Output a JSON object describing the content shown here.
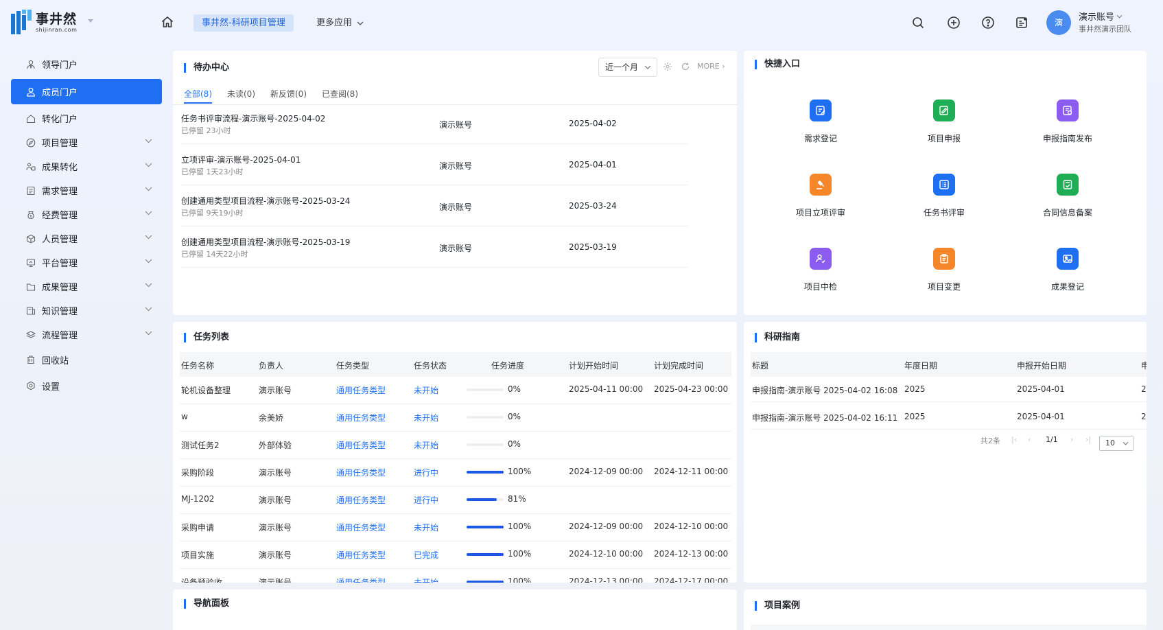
{
  "brand": {
    "name": "事井然",
    "sub": "shijinran.com",
    "accent": "#1e6ff1"
  },
  "header": {
    "current_app": "事井然-科研项目管理",
    "more_apps": "更多应用",
    "user": {
      "avatar_text": "演",
      "name": "演示账号",
      "team": "事井然演示团队"
    },
    "icons": [
      "home-icon",
      "search-icon",
      "add-circle-icon",
      "help-icon",
      "notice-icon"
    ]
  },
  "sidebar": {
    "items": [
      {
        "label": "领导门户",
        "icon": "user-tie-icon",
        "expandable": false
      },
      {
        "label": "成员门户",
        "icon": "user-icon",
        "expandable": false,
        "active": true
      },
      {
        "label": "转化门户",
        "icon": "home-outline-icon",
        "expandable": false
      },
      {
        "label": "项目管理",
        "icon": "compass-icon",
        "expandable": true
      },
      {
        "label": "成果转化",
        "icon": "exchange-icon",
        "expandable": true
      },
      {
        "label": "需求管理",
        "icon": "doc-icon",
        "expandable": true
      },
      {
        "label": "经费管理",
        "icon": "money-icon",
        "expandable": true
      },
      {
        "label": "人员管理",
        "icon": "cube-icon",
        "expandable": true
      },
      {
        "label": "平台管理",
        "icon": "monitor-icon",
        "expandable": true
      },
      {
        "label": "成果管理",
        "icon": "folder-icon",
        "expandable": true
      },
      {
        "label": "知识管理",
        "icon": "book-icon",
        "expandable": true
      },
      {
        "label": "流程管理",
        "icon": "layers-icon",
        "expandable": true
      },
      {
        "label": "回收站",
        "icon": "trash-icon",
        "expandable": false
      },
      {
        "label": "设置",
        "icon": "settings-icon",
        "expandable": false
      }
    ]
  },
  "todo": {
    "title": "待办中心",
    "period": "近一个月",
    "more": "MORE",
    "tabs": [
      "全部(8)",
      "未读(0)",
      "新反馈(0)",
      "已查阅(8)"
    ],
    "rows": [
      {
        "title": "任务书评审流程-演示账号-2025-04-02",
        "stay": "已停留 23小时",
        "user": "演示账号",
        "date": "2025-04-02"
      },
      {
        "title": "立项评审-演示账号-2025-04-01",
        "stay": "已停留 1天23小时",
        "user": "演示账号",
        "date": "2025-04-01"
      },
      {
        "title": "创建通用类型项目流程-演示账号-2025-03-24",
        "stay": "已停留 9天19小时",
        "user": "演示账号",
        "date": "2025-03-24"
      },
      {
        "title": "创建通用类型项目流程-演示账号-2025-03-19",
        "stay": "已停留 14天22小时",
        "user": "演示账号",
        "date": "2025-03-19"
      }
    ]
  },
  "quick_entry": {
    "title": "快捷入口",
    "items": [
      {
        "label": "需求登记",
        "color": "#1e6ff1",
        "icon": "edit-doc-icon"
      },
      {
        "label": "项目申报",
        "color": "#1fae55",
        "icon": "pen-doc-icon"
      },
      {
        "label": "申报指南发布",
        "color": "#8c5cf0",
        "icon": "guide-doc-icon"
      },
      {
        "label": "项目立项评审",
        "color": "#f5862a",
        "icon": "gavel-icon"
      },
      {
        "label": "任务书评审",
        "color": "#1e6ff1",
        "icon": "list-icon"
      },
      {
        "label": "合同信息备案",
        "color": "#1fae55",
        "icon": "contract-icon"
      },
      {
        "label": "项目中检",
        "color": "#8c5cf0",
        "icon": "inspect-icon"
      },
      {
        "label": "项目变更",
        "color": "#f5862a",
        "icon": "clipboard-icon"
      },
      {
        "label": "成果登记",
        "color": "#1e6ff1",
        "icon": "achievement-icon"
      }
    ]
  },
  "tasks": {
    "title": "任务列表",
    "columns": [
      "任务名称",
      "负责人",
      "任务类型",
      "任务状态",
      "任务进度",
      "计划开始时间",
      "计划完成时间"
    ],
    "rows": [
      {
        "name": "轮机设备整理",
        "owner": "演示账号",
        "type": "通用任务类型",
        "status": "未开始",
        "progress": 0,
        "progress_text": "0%",
        "start": "2025-04-11 00:00",
        "end": "2025-04-23 00:00"
      },
      {
        "name": "w",
        "owner": "余美娇",
        "type": "通用任务类型",
        "status": "未开始",
        "progress": 0,
        "progress_text": "0%",
        "start": "",
        "end": ""
      },
      {
        "name": "测试任务2",
        "owner": "外部体验",
        "type": "通用任务类型",
        "status": "未开始",
        "progress": 0,
        "progress_text": "0%",
        "start": "",
        "end": ""
      },
      {
        "name": "采购阶段",
        "owner": "演示账号",
        "type": "通用任务类型",
        "status": "进行中",
        "progress": 100,
        "progress_text": "100%",
        "start": "2024-12-09 00:00",
        "end": "2024-12-11 00:00"
      },
      {
        "name": "MJ-1202",
        "owner": "演示账号",
        "type": "通用任务类型",
        "status": "进行中",
        "progress": 81,
        "progress_text": "81%",
        "start": "",
        "end": ""
      },
      {
        "name": "采购申请",
        "owner": "演示账号",
        "type": "通用任务类型",
        "status": "未开始",
        "progress": 100,
        "progress_text": "100%",
        "start": "2024-12-09 00:00",
        "end": "2024-12-10 00:00"
      },
      {
        "name": "项目实施",
        "owner": "演示账号",
        "type": "通用任务类型",
        "status": "已完成",
        "progress": 100,
        "progress_text": "100%",
        "start": "2024-12-10 00:00",
        "end": "2024-12-13 00:00"
      },
      {
        "name": "设备预验收",
        "owner": "演示账号",
        "type": "通用任务类型",
        "status": "未开始",
        "progress": 100,
        "progress_text": "100%",
        "start": "2024-12-13 00:00",
        "end": "2024-12-17 00:00"
      }
    ]
  },
  "guide": {
    "title": "科研指南",
    "columns": [
      "标题",
      "年度日期",
      "申报开始日期",
      "申"
    ],
    "rows": [
      {
        "title": "申报指南-演示账号 2025-04-02 16:08",
        "year": "2025",
        "start": "2025-04-01",
        "extra": "2"
      },
      {
        "title": "申报指南-演示账号 2025-04-02 16:11",
        "year": "2025",
        "start": "2025-04-01",
        "extra": "2"
      }
    ],
    "pager": {
      "total": "共2条",
      "page": "1/1",
      "size": "10"
    }
  },
  "nav_panel": {
    "title": "导航面板"
  },
  "cases": {
    "title": "项目案例"
  }
}
